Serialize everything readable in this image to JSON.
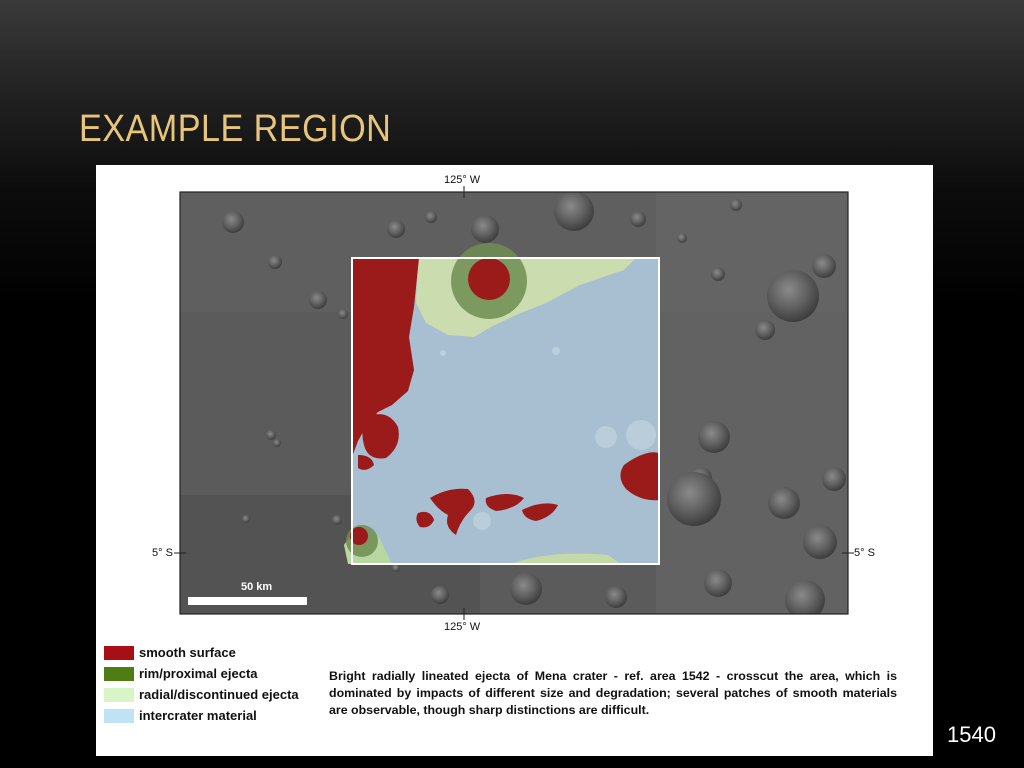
{
  "slide": {
    "title": "EXAMPLE REGION",
    "number": "1540"
  },
  "map": {
    "top_longitude_label": "125° W",
    "bottom_longitude_label": "125° W",
    "left_latitude_label": "5° S",
    "right_latitude_label": "5° S",
    "scale_bar_label": "50 km"
  },
  "legend": [
    {
      "label": "smooth surface",
      "color": "#a50f15"
    },
    {
      "label": "rim/proximal ejecta",
      "color": "#4e7d14"
    },
    {
      "label": "radial/discontinued ejecta",
      "color": "#d9f5c7"
    },
    {
      "label": "intercrater material",
      "color": "#bfe3f5"
    }
  ],
  "caption": "Bright radially lineated ejecta of Mena crater - ref. area 1542 - crosscut the area, which is dominated by impacts of different size and degradation; several patches of smooth materials are observable, though sharp distinctions are difficult.",
  "colors": {
    "title": "#e7c57b",
    "terrain": "#5e5e5e",
    "study_box": "#ffffff"
  }
}
